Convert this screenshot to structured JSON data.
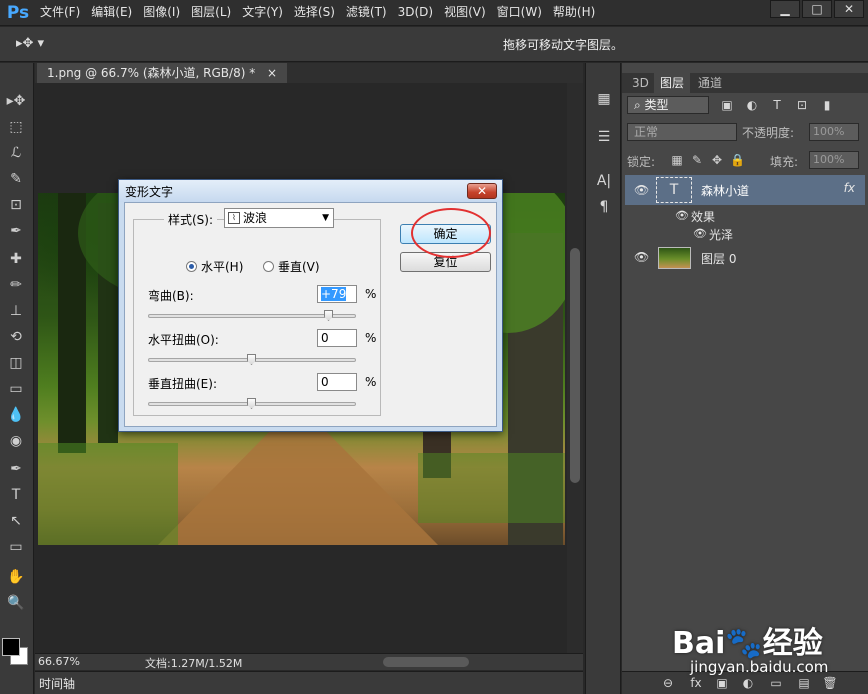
{
  "app": {
    "logo": "Ps"
  },
  "menu": [
    "文件(F)",
    "编辑(E)",
    "图像(I)",
    "图层(L)",
    "文字(Y)",
    "选择(S)",
    "滤镜(T)",
    "3D(D)",
    "视图(V)",
    "窗口(W)",
    "帮助(H)"
  ],
  "window_controls": {
    "minimize": "▁",
    "maximize": "□",
    "close": "✕"
  },
  "options_bar": {
    "tool_glyph": "▸✥ ▾",
    "hint": "拖移可移动文字图层。"
  },
  "document": {
    "tab_title": "1.png @ 66.7% (森林小道, RGB/8) *",
    "tab_close": "×",
    "zoom": "66.67%",
    "doc_info": "文档:1.27M/1.52M"
  },
  "timeline": {
    "label": "时间轴"
  },
  "tools": [
    "▸✥",
    "⬚",
    "ℒ",
    "✎",
    "⊡",
    "✒",
    "✚",
    "✏",
    "⊥",
    "⟲",
    "◫",
    "▭",
    "💧",
    "◉",
    "✒",
    "T",
    "↖",
    "▭",
    "✋",
    "🔍"
  ],
  "mid_icons": [
    "▦",
    "☰",
    "A|",
    "¶"
  ],
  "panel": {
    "tabs": [
      "3D",
      "图层",
      "通道"
    ],
    "active_tab": "图层",
    "filter_label": "⌕ 类型",
    "filter_icons": [
      "▣",
      "◐",
      "T",
      "⊡",
      "▮"
    ],
    "blend_mode": "正常",
    "opacity_label": "不透明度:",
    "opacity_value": "100%",
    "lock_label": "锁定:",
    "lock_icons": [
      "▦",
      "✎",
      "✥",
      "🔒"
    ],
    "fill_label": "填充:",
    "fill_value": "100%",
    "bottom_icons": [
      "⊖",
      "fx",
      "▣",
      "◐",
      "▭",
      "▤",
      "🗑"
    ]
  },
  "layers": {
    "text_layer": {
      "thumb": "T",
      "name": "森林小道",
      "fx": "fx"
    },
    "effects_label": "效果",
    "effect_item": "光泽",
    "image_layer": {
      "name": "图层 0"
    },
    "eye_glyph": "👁"
  },
  "dialog": {
    "title": "变形文字",
    "close": "✕",
    "style_label": "样式(S):",
    "style_value": "波浪",
    "style_icon": "⌇",
    "orientation": {
      "horizontal": "水平(H)",
      "vertical": "垂直(V)",
      "selected": "horizontal"
    },
    "bend": {
      "label": "弯曲(B):",
      "value": "+79",
      "pct": "%",
      "level": 79
    },
    "h_distort": {
      "label": "水平扭曲(O):",
      "value": "0",
      "pct": "%",
      "level": 0
    },
    "v_distort": {
      "label": "垂直扭曲(E):",
      "value": "0",
      "pct": "%",
      "level": 0
    },
    "ok": "确定",
    "reset": "复位"
  },
  "watermark": {
    "brand": "Bai🐾经验",
    "url": "jingyan.baidu.com"
  }
}
